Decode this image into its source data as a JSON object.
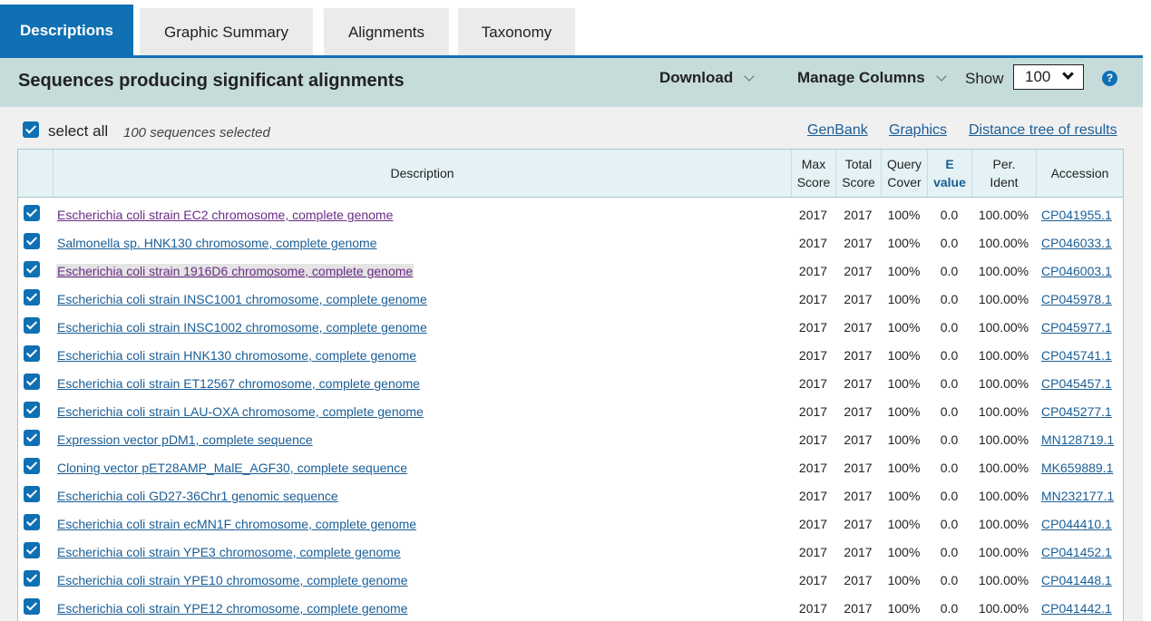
{
  "tabs": [
    {
      "label": "Descriptions"
    },
    {
      "label": "Graphic Summary"
    },
    {
      "label": "Alignments"
    },
    {
      "label": "Taxonomy"
    }
  ],
  "header": {
    "title": "Sequences producing significant alignments",
    "download_label": "Download",
    "manage_columns_label": "Manage Columns",
    "show_label": "Show",
    "show_value": "100",
    "help_glyph": "?"
  },
  "selection": {
    "select_all_label": "select all",
    "count_text": "100 sequences selected"
  },
  "links": {
    "genbank": "GenBank",
    "graphics": "Graphics",
    "distance_tree": "Distance tree of results"
  },
  "columns": {
    "description": "Description",
    "max_score": [
      "Max",
      "Score"
    ],
    "total_score": [
      "Total",
      "Score"
    ],
    "query_cover": [
      "Query",
      "Cover"
    ],
    "e_value": [
      "E",
      "value"
    ],
    "per_ident": [
      "Per.",
      "Ident"
    ],
    "accession": "Accession"
  },
  "rows": [
    {
      "description": "Escherichia coli strain EC2 chromosome, complete genome",
      "max_score": "2017",
      "total_score": "2017",
      "query_cover": "100%",
      "e_value": "0.0",
      "per_ident": "100.00%",
      "accession": "CP041955.1"
    },
    {
      "description": "Salmonella sp. HNK130 chromosome, complete genome",
      "max_score": "2017",
      "total_score": "2017",
      "query_cover": "100%",
      "e_value": "0.0",
      "per_ident": "100.00%",
      "accession": "CP046033.1"
    },
    {
      "description": "Escherichia coli strain 1916D6 chromosome, complete genome",
      "max_score": "2017",
      "total_score": "2017",
      "query_cover": "100%",
      "e_value": "0.0",
      "per_ident": "100.00%",
      "accession": "CP046003.1"
    },
    {
      "description": "Escherichia coli strain INSC1001 chromosome, complete genome",
      "max_score": "2017",
      "total_score": "2017",
      "query_cover": "100%",
      "e_value": "0.0",
      "per_ident": "100.00%",
      "accession": "CP045978.1"
    },
    {
      "description": "Escherichia coli strain INSC1002 chromosome, complete genome",
      "max_score": "2017",
      "total_score": "2017",
      "query_cover": "100%",
      "e_value": "0.0",
      "per_ident": "100.00%",
      "accession": "CP045977.1"
    },
    {
      "description": "Escherichia coli strain HNK130 chromosome, complete genome",
      "max_score": "2017",
      "total_score": "2017",
      "query_cover": "100%",
      "e_value": "0.0",
      "per_ident": "100.00%",
      "accession": "CP045741.1"
    },
    {
      "description": "Escherichia coli strain ET12567 chromosome, complete genome",
      "max_score": "2017",
      "total_score": "2017",
      "query_cover": "100%",
      "e_value": "0.0",
      "per_ident": "100.00%",
      "accession": "CP045457.1"
    },
    {
      "description": "Escherichia coli strain LAU-OXA chromosome, complete genome",
      "max_score": "2017",
      "total_score": "2017",
      "query_cover": "100%",
      "e_value": "0.0",
      "per_ident": "100.00%",
      "accession": "CP045277.1"
    },
    {
      "description": "Expression vector pDM1, complete sequence",
      "max_score": "2017",
      "total_score": "2017",
      "query_cover": "100%",
      "e_value": "0.0",
      "per_ident": "100.00%",
      "accession": "MN128719.1"
    },
    {
      "description": "Cloning vector pET28AMP_MalE_AGF30, complete sequence",
      "max_score": "2017",
      "total_score": "2017",
      "query_cover": "100%",
      "e_value": "0.0",
      "per_ident": "100.00%",
      "accession": "MK659889.1"
    },
    {
      "description": "Escherichia coli GD27-36Chr1 genomic sequence",
      "max_score": "2017",
      "total_score": "2017",
      "query_cover": "100%",
      "e_value": "0.0",
      "per_ident": "100.00%",
      "accession": "MN232177.1"
    },
    {
      "description": "Escherichia coli strain ecMN1F chromosome, complete genome",
      "max_score": "2017",
      "total_score": "2017",
      "query_cover": "100%",
      "e_value": "0.0",
      "per_ident": "100.00%",
      "accession": "CP044410.1"
    },
    {
      "description": "Escherichia coli strain YPE3 chromosome, complete genome",
      "max_score": "2017",
      "total_score": "2017",
      "query_cover": "100%",
      "e_value": "0.0",
      "per_ident": "100.00%",
      "accession": "CP041452.1"
    },
    {
      "description": "Escherichia coli strain YPE10 chromosome, complete genome",
      "max_score": "2017",
      "total_score": "2017",
      "query_cover": "100%",
      "e_value": "0.0",
      "per_ident": "100.00%",
      "accession": "CP041448.1"
    },
    {
      "description": "Escherichia coli strain YPE12 chromosome, complete genome",
      "max_score": "2017",
      "total_score": "2017",
      "query_cover": "100%",
      "e_value": "0.0",
      "per_ident": "100.00%",
      "accession": "CP041442.1"
    }
  ],
  "colors": {
    "primary": "#0f70b3",
    "header_bg": "#c5dcda",
    "link": "#1a5e96",
    "visited_link": "#6a2c86"
  },
  "icons": {
    "checkbox": "checkbox-checked-icon",
    "dropdown": "chevron-down-icon",
    "help": "help-circle-icon"
  }
}
